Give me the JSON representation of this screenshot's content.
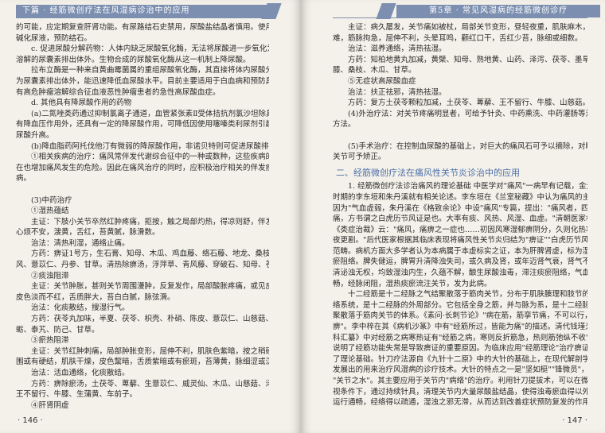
{
  "left_page": {
    "header": "下篇 · 经筋微创疗法在风湿病诊治中的应用",
    "lines": [
      {
        "t": "的可能，应定期复查肝肾功能。有尿路结石史禁用，尿酸盐结晶者慎用。使用时需",
        "i": false
      },
      {
        "t": "碱化尿液，预防结石。",
        "i": false
      },
      {
        "t": "c. 促进尿酸分解药物：人体内缺乏尿酸氧化酶，无法将尿酸进一步氧化为更易",
        "i": true
      },
      {
        "t": "溶解的尿囊素排出体外。生物合成的尿酸氧化酶从这一机制上降尿酸。",
        "i": false
      },
      {
        "t": "拉布立酶是一种来自黄曲霉菌属的重组尿酸氧化酶，其直接将体内尿酸分解",
        "i": true
      },
      {
        "t": "为尿囊素排出体外，能迅速降低血尿酸水平。目前主要适用于白血病和预防具",
        "i": false
      },
      {
        "t": "有高危肿瘤溶解综合征血液恶性肿瘤患者的急性高尿酸血症。",
        "i": false
      },
      {
        "t": "d. 其他具有降尿酸作用的药物",
        "i": true
      },
      {
        "t": "(a)二氮唑类药通过抑制氯离子通道，血管紧张素Ⅱ受体拮抗剂氯沙坦除具",
        "i": true
      },
      {
        "t": "有降血压作用外，还具有一定的降尿酸作用，可降低因使用噻嗪类利尿剂引起的血",
        "i": false
      },
      {
        "t": "尿酸升高。",
        "i": false
      },
      {
        "t": "(b)降血脂药阿托伐他汀有微弱的降尿酸作用，非诺贝特则可促进尿酸排泄。",
        "i": true
      },
      {
        "t": "①相关疾病的治疗：痛风常伴发代谢综合征中的一种或数种，这些疾病的存",
        "i": true
      },
      {
        "t": "在也增加痛风发生的危险。因此在痛风治疗的同时，应积极治疗相关的伴发疾",
        "i": false
      },
      {
        "t": "病。",
        "i": false
      },
      {
        "t": "",
        "i": false
      },
      {
        "t": "(3)中药治疗",
        "i": true
      },
      {
        "t": "①湿热蕴结",
        "i": true
      },
      {
        "t": "主证：下肢小关节卒然红肿疼痛，拒按，触之局部灼热，得凉则舒，伴发热口渴，",
        "i": true
      },
      {
        "t": "心烦不安，溲黄，舌红，苔黄腻，脉滑数。",
        "i": false
      },
      {
        "t": "治法：清热利湿，通络止痛。",
        "i": true
      },
      {
        "t": "方药：痹证1号方，生石膏、知母、木瓜、鸡血藤、络石藤、地龙、桑枝、忍冬藤、防",
        "i": true
      },
      {
        "t": "风、薏苡仁、丹参、甘草。清热除痹汤，浮萍草、青风藤、穿破石、知母、苍术。",
        "i": false
      },
      {
        "t": "②痰浊阻滞",
        "i": true
      },
      {
        "t": "主证：关节肿胀，甚则关节周围漫肿，反复发作，局部酸胀疼痛，或见皮下结节，",
        "i": true
      },
      {
        "t": "皮色淡而不红，舌质胖大，苔白白腻，脉弦滑。",
        "i": false
      },
      {
        "t": "治法：化痰散结，搜湿行气。",
        "i": true
      },
      {
        "t": "方药：茯苓丸加味，半夏、茯苓、枳壳、朴硝、陈皮、薏苡仁、山慈菇、浙贝母、牡",
        "i": true
      },
      {
        "t": "蛎、泰艽、防己、甘草。",
        "i": false
      },
      {
        "t": "③瘀热阻滞",
        "i": true
      },
      {
        "t": "主证：关节红肿刺痛，局部肿胀变形，屈伸不利，肌肤色紫暗，按之稍硬，病灶周",
        "i": true
      },
      {
        "t": "围或有硬结，肌肤干燥，皮色黧暗，舌质紫暗或有瘀斑，苔薄黄，脉细涩或沉弦。",
        "i": false
      },
      {
        "t": "治法：活血通络，化痰散结。",
        "i": true
      },
      {
        "t": "方药：痹除瘀汤，土茯苓、萆薢、生薏苡仁、威灵仙、木瓜、山慈菇、泽泻、泽兰、",
        "i": true
      },
      {
        "t": "王不留行、牛膝、生蒲黄、车前子。",
        "i": false
      },
      {
        "t": "④肝肾阴虚",
        "i": true
      }
    ],
    "page_number": "· 146 ·"
  },
  "right_page": {
    "header": "第5章 · 常见风湿病的经筋微创诊疗",
    "lines_top": [
      {
        "t": "主证：病久屡发，关节痛如被杖，局部关节变形，昼轻夜重，肌肤麻木，步履艰",
        "i": true
      },
      {
        "t": "难，筋脉拘急，屈伸不利，头晕耳鸣，颧红口干，舌红少苔，脉细或细数。",
        "i": false
      },
      {
        "t": "治法：滋养通络，清热祛湿。",
        "i": true
      },
      {
        "t": "方药：知柏地黄丸加减，黄檗、知母、熟地黄、山药、泽泻、茯苓、墨旱莲、杜仲、牛",
        "i": true
      },
      {
        "t": "膝、桑枝、木瓜、甘草。",
        "i": false
      },
      {
        "t": "⑤无症状高尿酸血症",
        "i": true
      },
      {
        "t": "治法：扶正祛邪，清热祛湿。",
        "i": true
      },
      {
        "t": "方药：复方土茯苓颗粒加减，土茯苓、萆薢、王不留行、牛膝、山慈菇。",
        "i": true
      },
      {
        "t": "(4)外治疗法：对关节疼痛明显者，可给予针灸、中药熏洗、中药灌肠等治疗",
        "i": true
      },
      {
        "t": "方法。",
        "i": false
      },
      {
        "t": "",
        "i": false
      },
      {
        "t": "(5)手术治疗：在控制血尿酸的基础上，对巨大的痛风石可予以摘除，对畸形的",
        "i": true
      },
      {
        "t": "关节可予矫正。",
        "i": false
      }
    ],
    "section_title": "二、经筋微创疗法在痛风性关节炎诊治中的应用",
    "lines_bottom": [
      {
        "t": "1. 经筋微创疗法诊治痛风的理论基础  中医学对\"痛风\"一病早有记载，金元",
        "i": true
      },
      {
        "t": "时期的李东垣和朱丹溪就有相关论述。李东垣在《兰室秘藏》中认为痛风的主要病",
        "i": false
      },
      {
        "t": "因为\"气血虚弱，朱丹溪在《格致余论》中设\"痛风\"专篇，提出：\"痛风者，四肢百节走",
        "i": false
      },
      {
        "t": "痛，方书谓之白虎历节风证是也。大率有痰、风热、风湿、血虚。\"清朝医家林佩琴",
        "i": false
      },
      {
        "t": "《类症治裁》云：\"痛风，痛痹之一症也……初因风寒湿郁痹阴分，久则化热攻痛，至",
        "i": false
      },
      {
        "t": "夜更剧。\"后代医家根据其临床表现将痛风性关节炎归结为\"痹证\"\"白虎历节风\"等",
        "i": false
      },
      {
        "t": "范畴。病机方面大多学者认为本病属于本虚标实之证，本为肝脾肾虚，标为湿浊痰",
        "i": false
      },
      {
        "t": "瘀阻络。脾失健运，脾胃升清降浊失司，或久病及肾，或年迈肾气衰，肾气不化，分",
        "i": false
      },
      {
        "t": "清泌浊无权，均致湿浊内生，久蕴不解，酿生尿酸浊毒，滞注痰瘀阻络，气血运行不",
        "i": false
      },
      {
        "t": "畅，经脉闭阻，湿热痰瘀流注关节，发为此病。",
        "i": false
      },
      {
        "t": "十二经筋是十二经脉之气结聚散落于筋肉关节，分布于肌肤腠理和肢节的经",
        "i": true
      },
      {
        "t": "络系统，是十二经脉的外周部分。它包括全身之筋，并与脉为系，是十二经脉之气结",
        "i": false
      },
      {
        "t": "聚散落于筋肉关节的体系。《素问·长刺节论》\"病在筋，筋挛节痛，不可以行，名为痹",
        "i": false
      },
      {
        "t": "痹\"。李中梓在其《病机沙篆》中有\"经筋所过，皆能为痛\"的描述。清代钱瑾光在《伤",
        "i": false
      },
      {
        "t": "科汇纂》中对经筋之病寒热证有\"经筋之病，寒则反折筋急，热则筋弛纵不收\"的记载，",
        "i": false
      },
      {
        "t": "说明了经筋功能失常是导致痹证的重要原因。为临床应用\"经筋理论\"治疗痹证奠定",
        "i": false
      },
      {
        "t": "了理论基础。针刀疗法源自《九针十二原》中的大针的基础上，在现代解剖学基础",
        "i": false
      },
      {
        "t": "发展出的用来治疗风湿病的诊疗技术。大针的特点之一是\"坚如梃\"\"锋微员\"，可以",
        "i": false
      },
      {
        "t": "\"关节之水\"。其主要应用于关节内\"病络\"的治疗。利用针刀提拔术，可以在微创、可",
        "i": false
      },
      {
        "t": "视条件下，通过持续针具，清理关节内大量尿酸盐结晶，使得浊毒瘀血得以外出，气血",
        "i": false
      },
      {
        "t": "运行通畅，经络得以疏通，湿浊之邪无滞，从而达到改善症状预防复发的作用。编者在\"经",
        "i": false
      }
    ],
    "page_number": "· 147 ·"
  }
}
